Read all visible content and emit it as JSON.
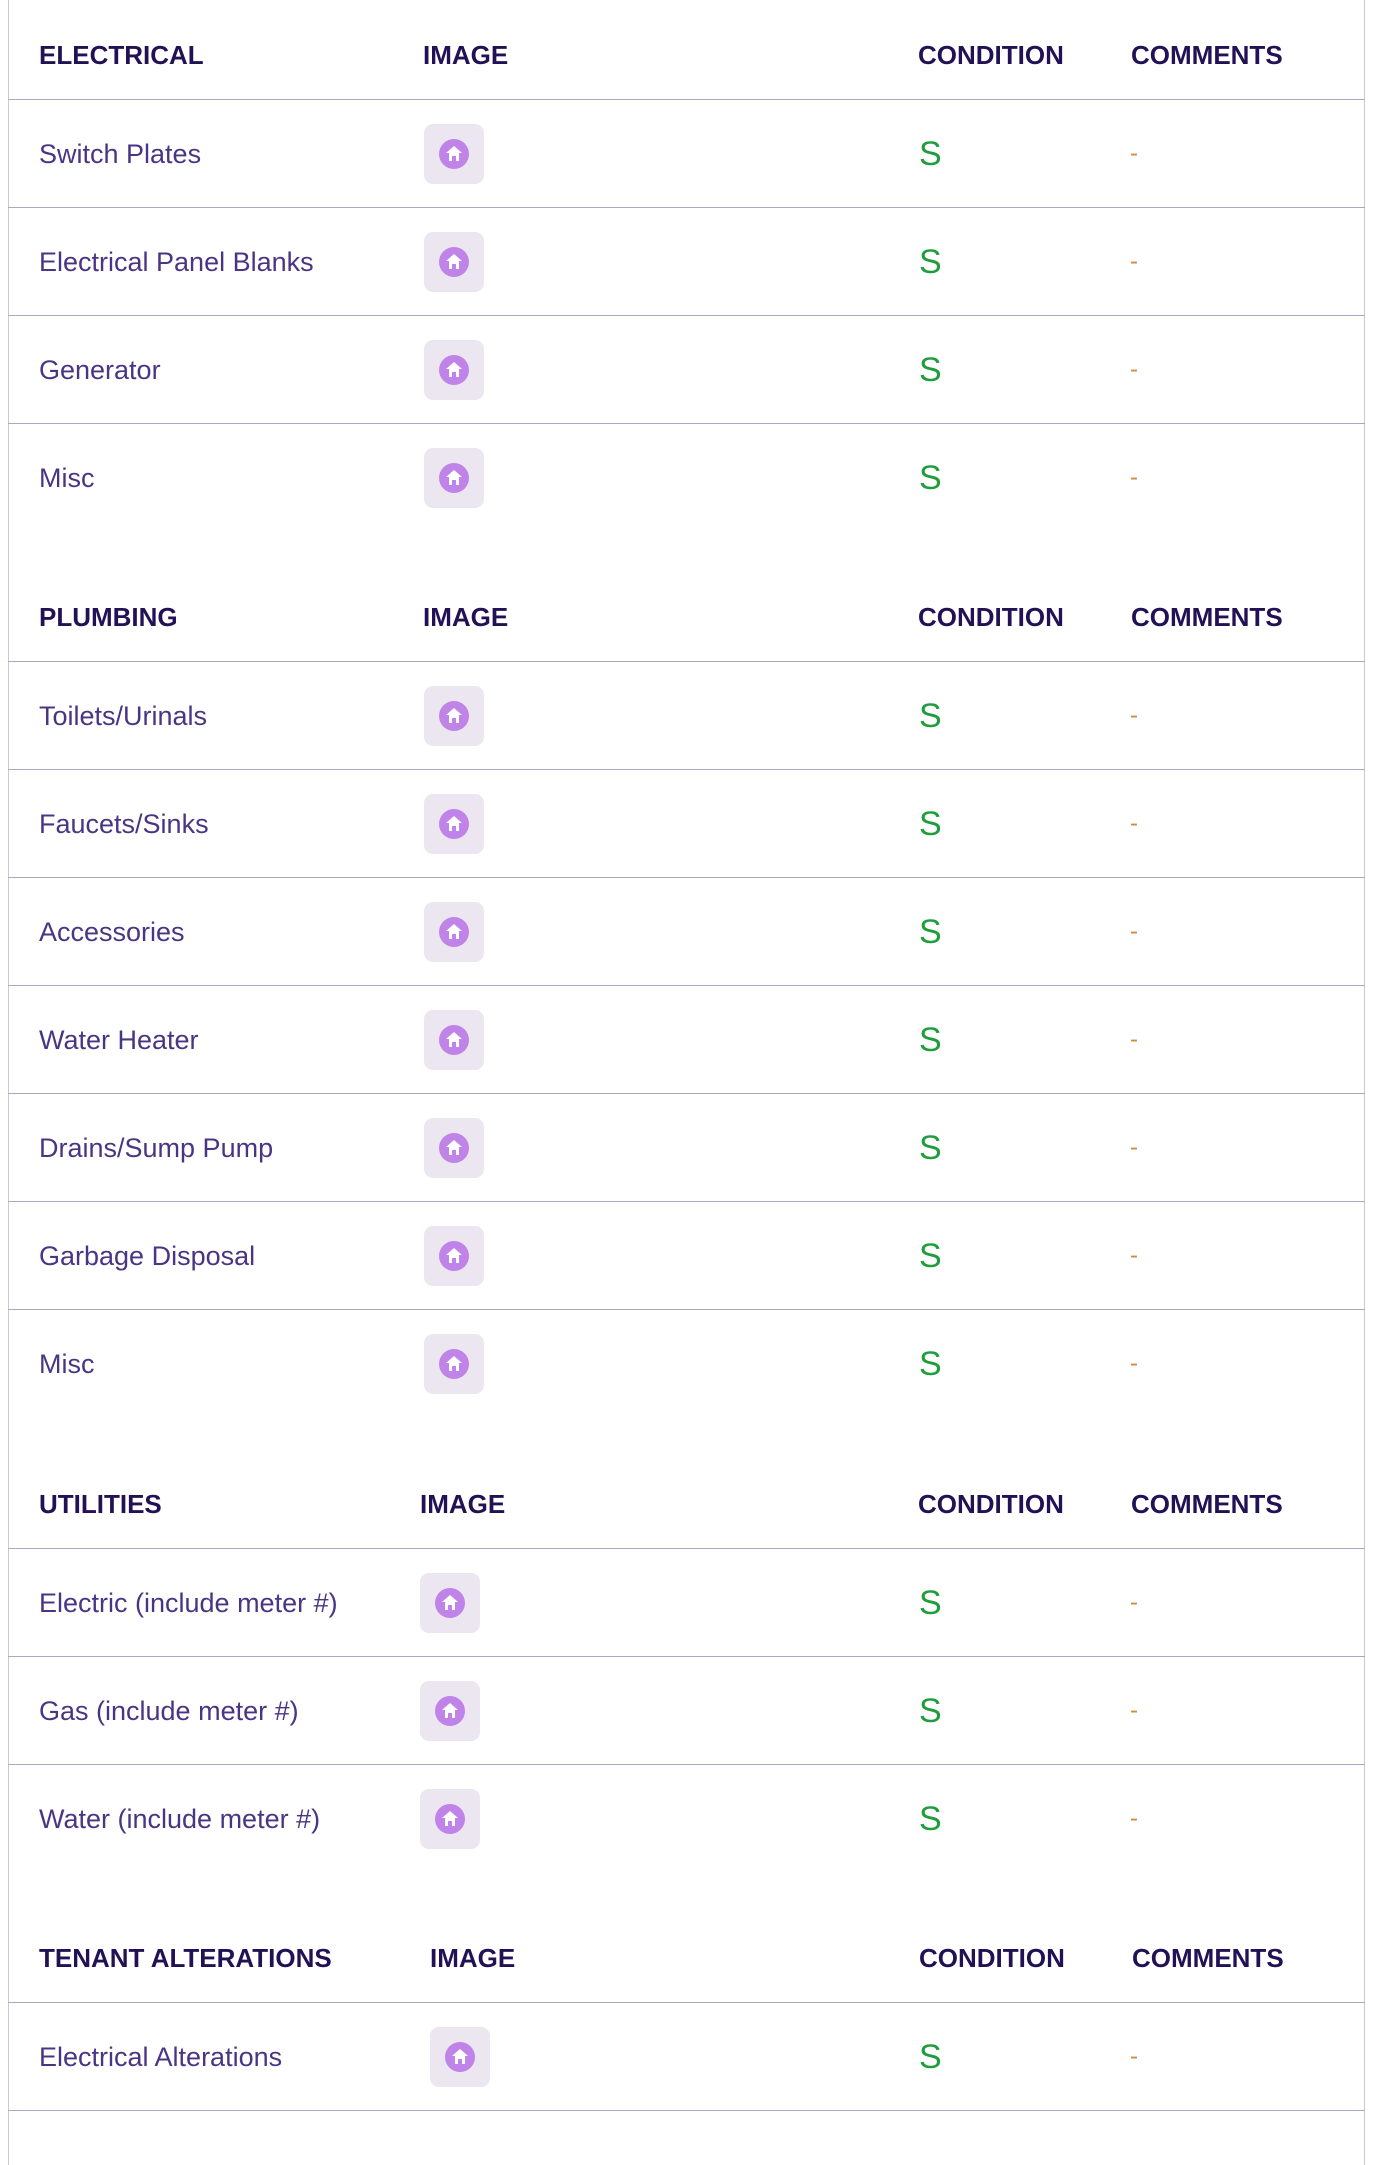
{
  "sections": [
    {
      "header": {
        "category": "ELECTRICAL",
        "image": "IMAGE",
        "condition": "CONDITION",
        "comments": "COMMENTS"
      },
      "rows": [
        {
          "name": "Switch Plates",
          "condition": "S",
          "comment": "-"
        },
        {
          "name": "Electrical Panel Blanks",
          "condition": "S",
          "comment": "-"
        },
        {
          "name": "Generator",
          "condition": "S",
          "comment": "-"
        },
        {
          "name": "Misc",
          "condition": "S",
          "comment": "-"
        }
      ]
    },
    {
      "header": {
        "category": "PLUMBING",
        "image": "IMAGE",
        "condition": "CONDITION",
        "comments": "COMMENTS"
      },
      "rows": [
        {
          "name": "Toilets/Urinals",
          "condition": "S",
          "comment": "-"
        },
        {
          "name": "Faucets/Sinks",
          "condition": "S",
          "comment": "-"
        },
        {
          "name": "Accessories",
          "condition": "S",
          "comment": "-"
        },
        {
          "name": "Water Heater",
          "condition": "S",
          "comment": "-"
        },
        {
          "name": "Drains/Sump Pump",
          "condition": "S",
          "comment": "-"
        },
        {
          "name": "Garbage Disposal",
          "condition": "S",
          "comment": "-"
        },
        {
          "name": "Misc",
          "condition": "S",
          "comment": "-"
        }
      ]
    },
    {
      "header": {
        "category": "UTILITIES",
        "image": "IMAGE",
        "condition": "CONDITION",
        "comments": "COMMENTS"
      },
      "rows": [
        {
          "name": "Electric (include meter #)",
          "condition": "S",
          "comment": "-"
        },
        {
          "name": "Gas (include meter #)",
          "condition": "S",
          "comment": "-"
        },
        {
          "name": "Water (include meter #)",
          "condition": "S",
          "comment": "-"
        }
      ]
    },
    {
      "header": {
        "category": "TENANT ALTERATIONS",
        "image": "IMAGE",
        "condition": "CONDITION",
        "comments": "COMMENTS"
      },
      "rows": [
        {
          "name": "Electrical Alterations",
          "condition": "S",
          "comment": "-"
        }
      ]
    }
  ],
  "thumbnail_icon": "home-icon",
  "colors": {
    "header_text": "#221155",
    "item_text": "#4a3585",
    "condition_good": "#1f9d3c",
    "comment_text": "#d38a3a",
    "thumbnail_bg": "#ebe6f0",
    "icon_purple": "#c084e8"
  }
}
